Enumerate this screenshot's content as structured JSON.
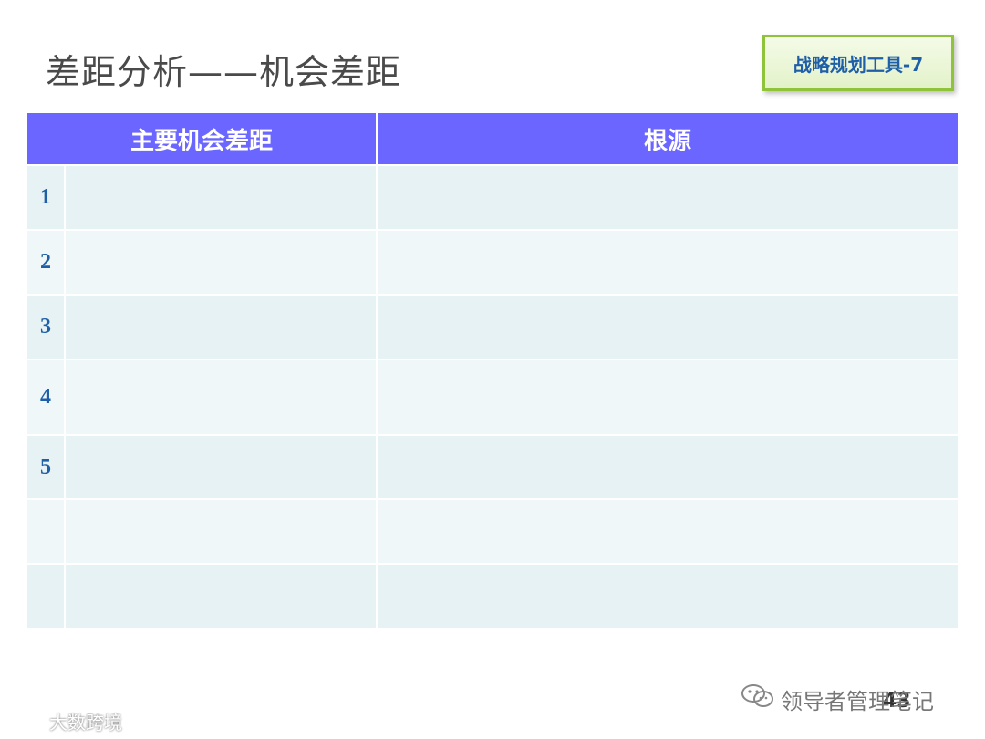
{
  "slide": {
    "title": "差距分析——机会差距",
    "tool_badge": "战略规划工具-7",
    "page_number": "43"
  },
  "table": {
    "headers": [
      "主要机会差距",
      "根源"
    ],
    "row_labels": [
      "1",
      "2",
      "3",
      "4",
      "5",
      "",
      ""
    ]
  },
  "watermarks": {
    "right": "领导者管理笔记",
    "left": "大数跨境"
  }
}
